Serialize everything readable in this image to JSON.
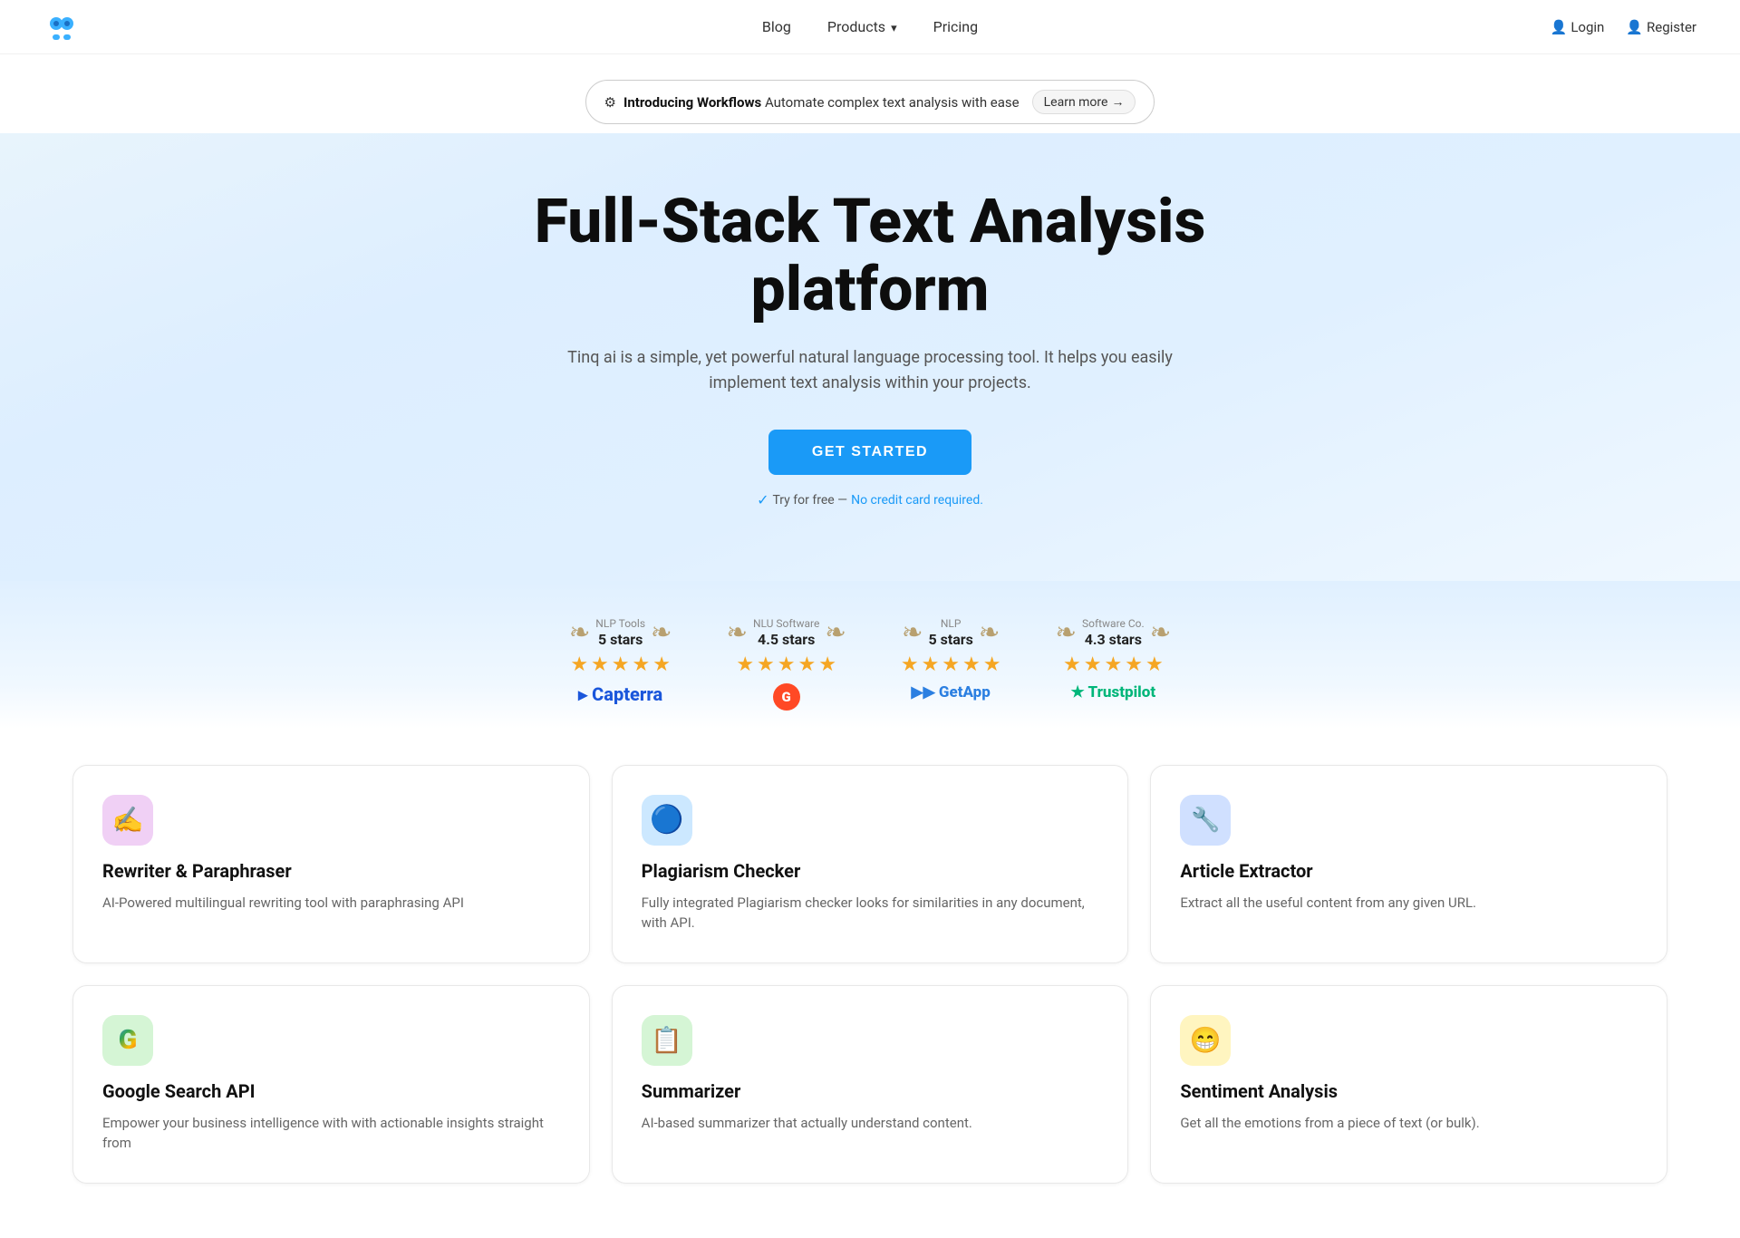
{
  "nav": {
    "logo_alt": "Tinq AI Logo",
    "links": [
      {
        "id": "blog",
        "label": "Blog",
        "has_dropdown": false
      },
      {
        "id": "products",
        "label": "Products",
        "has_dropdown": true
      },
      {
        "id": "pricing",
        "label": "Pricing",
        "has_dropdown": false
      }
    ],
    "auth": [
      {
        "id": "login",
        "label": "Login",
        "icon": "person-icon"
      },
      {
        "id": "register",
        "label": "Register",
        "icon": "person-add-icon"
      }
    ]
  },
  "banner": {
    "icon": "⚙",
    "intro_bold": "Introducing Workflows",
    "intro_text": "Automate complex text analysis with ease",
    "cta_label": "Learn more",
    "cta_arrow": "→"
  },
  "hero": {
    "title_line1": "Full-Stack Text Analysis",
    "title_line2": "platform",
    "subtitle": "Tinq ai is a simple, yet powerful natural language processing tool. It helps you easily implement text analysis within your projects.",
    "cta_label": "GET STARTED",
    "try_text": "Try for free — ",
    "try_link": "No credit card required."
  },
  "ratings": [
    {
      "id": "nlp-tools",
      "category": "NLP Tools",
      "stars_text": "5 stars",
      "stars": 5,
      "half": false,
      "platform": "Capterra",
      "platform_type": "capterra"
    },
    {
      "id": "nlu-software",
      "category": "NLU Software",
      "stars_text": "4.5 stars",
      "stars": 4,
      "half": true,
      "platform": "G2",
      "platform_type": "g2"
    },
    {
      "id": "nlp",
      "category": "NLP",
      "stars_text": "5 stars",
      "stars": 5,
      "half": false,
      "platform": "GetApp",
      "platform_type": "getapp"
    },
    {
      "id": "software-co",
      "category": "Software Co.",
      "stars_text": "4.3 stars",
      "stars": 4,
      "half": true,
      "platform": "Trustpilot",
      "platform_type": "trustpilot"
    }
  ],
  "products": [
    {
      "id": "rewriter",
      "icon": "✍️",
      "icon_bg": "#e8d5f5",
      "name": "Rewriter & Paraphraser",
      "description": "AI-Powered multilingual rewriting tool with paraphrasing API"
    },
    {
      "id": "plagiarism",
      "icon": "🔵",
      "icon_bg": "#d0eeff",
      "name": "Plagiarism Checker",
      "description": "Fully integrated Plagiarism checker looks for similarities in any document, with API."
    },
    {
      "id": "article-extractor",
      "icon": "🔧",
      "icon_bg": "#d0e8ff",
      "name": "Article Extractor",
      "description": "Extract all the useful content from any given URL."
    },
    {
      "id": "google-search",
      "icon": "G",
      "icon_bg": "#e0f5e0",
      "name": "Google Search API",
      "description": "Empower your business intelligence with with actionable insights straight from"
    },
    {
      "id": "summarizer",
      "icon": "📋",
      "icon_bg": "#e0f5e0",
      "name": "Summarizer",
      "description": "AI-based summarizer that actually understand content."
    },
    {
      "id": "sentiment-analysis",
      "icon": "😁",
      "icon_bg": "#fff5c0",
      "name": "Sentiment Analysis",
      "description": "Get all the emotions from a piece of text (or bulk)."
    }
  ]
}
